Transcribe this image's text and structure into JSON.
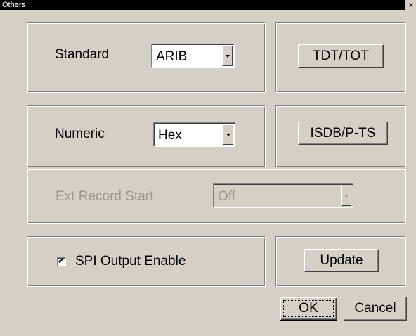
{
  "window": {
    "title": "Others",
    "close_glyph": "×"
  },
  "standard": {
    "label": "Standard",
    "value": "ARIB"
  },
  "numeric": {
    "label": "Numeric",
    "value": "Hex"
  },
  "ext_record": {
    "label": "Ext Record Start",
    "value": "Off"
  },
  "spi": {
    "label": "SPI Output Enable",
    "checked": true,
    "check_glyph": "✔"
  },
  "buttons": {
    "tdt_tot": "TDT/TOT",
    "isdb_pts": "ISDB/P-TS",
    "update": "Update",
    "ok": "OK",
    "cancel": "Cancel"
  },
  "colors": {
    "face": "#d4d0c8",
    "disabled_text": "#9c9a94"
  }
}
